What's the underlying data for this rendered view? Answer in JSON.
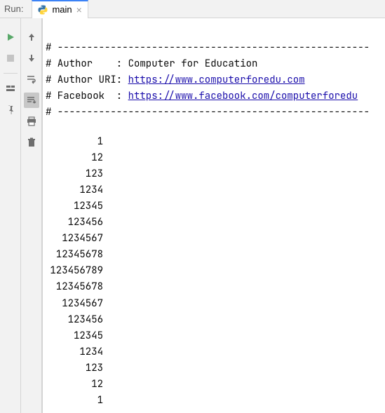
{
  "panel": {
    "label": "Run:"
  },
  "tab": {
    "file_label": "main"
  },
  "header": {
    "divider": "# -----------------------------------------------------",
    "author_prefix": "# Author    : ",
    "author_value": "Computer for Education",
    "uri_prefix": "# Author URI: ",
    "uri_link": "https://www.computerforedu.com",
    "fb_prefix": "# Facebook  : ",
    "fb_link": "https://www.facebook.com/computerforedu"
  },
  "output_lines": [
    "1",
    "12",
    "123",
    "1234",
    "12345",
    "123456",
    "1234567",
    "12345678",
    "123456789",
    "12345678",
    "1234567",
    "123456",
    "12345",
    "1234",
    "123",
    "12",
    "1"
  ]
}
